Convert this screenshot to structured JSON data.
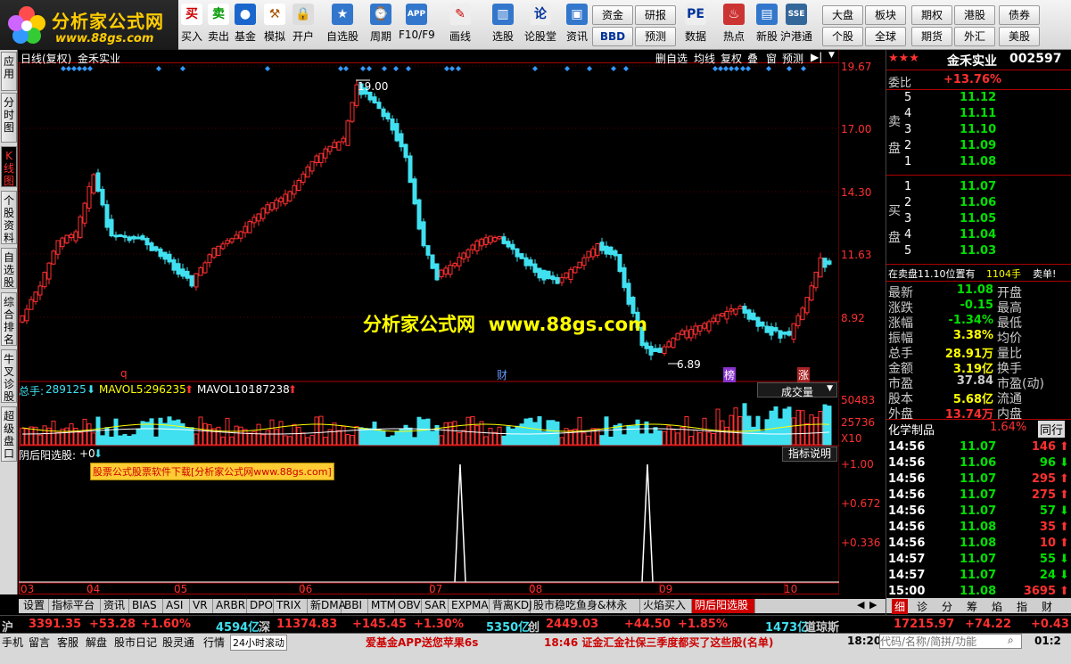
{
  "logo": {
    "title": "分析家公式网",
    "url": "www.88gs.com"
  },
  "toolbar": {
    "buttons": [
      {
        "label": "买入",
        "icon": "买"
      },
      {
        "label": "卖出",
        "icon": "卖"
      },
      {
        "label": "基金",
        "icon": "●"
      },
      {
        "label": "模拟",
        "icon": "⚒"
      },
      {
        "label": "开户",
        "icon": "🔒"
      },
      {
        "label": "自选股",
        "icon": "★"
      },
      {
        "label": "周期",
        "icon": "⌚"
      },
      {
        "label": "F10/F9",
        "icon": "APP"
      },
      {
        "label": "画线",
        "icon": "✎"
      },
      {
        "label": "选股",
        "icon": "▥"
      },
      {
        "label": "论股堂",
        "icon": "论"
      },
      {
        "label": "资讯",
        "icon": "▣"
      },
      {
        "label": "数据",
        "icon": "PE"
      },
      {
        "label": "热点",
        "icon": "♨"
      },
      {
        "label": "新股",
        "icon": "▤"
      },
      {
        "label": "沪港通",
        "icon": "SSE"
      }
    ],
    "small_buttons": [
      "资金",
      "BBD",
      "研报",
      "预测",
      "大盘",
      "个股",
      "板块",
      "全球",
      "期权",
      "期货",
      "港股",
      "外汇",
      "债券",
      "美股"
    ]
  },
  "sidetabs": [
    "应用",
    "分时图",
    "K线图",
    "个股资料",
    "自选股",
    "综合排名",
    "牛叉诊股",
    "超级盘口"
  ],
  "chart": {
    "title": "日线(复权)",
    "stock": "金禾实业",
    "top_buttons": [
      "删自选",
      "均线",
      "复权",
      "叠",
      "窗",
      "预测"
    ],
    "price_labels": [
      "19.67",
      "17.00",
      "14.30",
      "11.63",
      "8.92"
    ],
    "high_label": "19.00",
    "low_label": "6.89",
    "watermark": "分析家公式网  www.88gs.com",
    "markers": [
      "q",
      "财",
      "榜",
      "涨"
    ],
    "volume": {
      "total_label": "总手:",
      "total": "289125",
      "ma5_label": "MAVOL5:",
      "ma5": "296235",
      "ma10_label": "MAVOL10:",
      "ma10": "187238",
      "dropdown": "成交量",
      "labels": [
        "50483",
        "25736",
        "X10"
      ]
    },
    "indicator": {
      "name": "阴后阳选股:",
      "value": "+0",
      "button": "指标说明",
      "ad": "股票公式股票软件下载[分析家公式网www.88gs.com]",
      "labels": [
        "+1.00",
        "+0.672",
        "+0.336"
      ]
    },
    "months": [
      "03",
      "04",
      "05",
      "06",
      "07",
      "08",
      "09",
      "10"
    ]
  },
  "right": {
    "stars": "★★★",
    "name": "金禾实业",
    "code": "002597",
    "weibi_label": "委比",
    "weibi": "+13.76%",
    "sell_label": "卖盘",
    "buy_label": "买盘",
    "sells": [
      {
        "n": "5",
        "p": "11.12"
      },
      {
        "n": "4",
        "p": "11.11"
      },
      {
        "n": "3",
        "p": "11.10"
      },
      {
        "n": "2",
        "p": "11.09"
      },
      {
        "n": "1",
        "p": "11.08"
      }
    ],
    "buys": [
      {
        "n": "1",
        "p": "11.07"
      },
      {
        "n": "2",
        "p": "11.06"
      },
      {
        "n": "3",
        "p": "11.05"
      },
      {
        "n": "4",
        "p": "11.04"
      },
      {
        "n": "5",
        "p": "11.03"
      }
    ],
    "order_info": "在卖盘11.10位置有",
    "order_qty": "1104手",
    "order_btn": "卖单!",
    "stats": [
      {
        "l": "最新",
        "v": "11.08",
        "r": "开盘"
      },
      {
        "l": "涨跌",
        "v": "-0.15",
        "r": "最高"
      },
      {
        "l": "涨幅",
        "v": "-1.34%",
        "r": "最低"
      },
      {
        "l": "振幅",
        "v": "3.38%",
        "r": "均价"
      },
      {
        "l": "总手",
        "v": "28.91万",
        "r": "量比"
      },
      {
        "l": "金额",
        "v": "3.19亿",
        "r": "换手"
      },
      {
        "l": "市盈",
        "v": "37.84",
        "r": "市盈(动)"
      },
      {
        "l": "股本",
        "v": "5.68亿",
        "r": "流通"
      },
      {
        "l": "外盘",
        "v": "13.74万",
        "r": "内盘"
      }
    ],
    "sector": "化学制品",
    "sector_pct": "1.64%",
    "sector_btn": "同行",
    "ticks": [
      {
        "t": "14:56",
        "p": "11.07",
        "v": "146"
      },
      {
        "t": "14:56",
        "p": "11.06",
        "v": "96"
      },
      {
        "t": "14:56",
        "p": "11.07",
        "v": "295"
      },
      {
        "t": "14:56",
        "p": "11.07",
        "v": "275"
      },
      {
        "t": "14:56",
        "p": "11.07",
        "v": "57"
      },
      {
        "t": "14:56",
        "p": "11.08",
        "v": "35"
      },
      {
        "t": "14:56",
        "p": "11.08",
        "v": "10"
      },
      {
        "t": "14:57",
        "p": "11.07",
        "v": "55"
      },
      {
        "t": "14:57",
        "p": "11.07",
        "v": "24"
      },
      {
        "t": "15:00",
        "p": "11.08",
        "v": "3695"
      }
    ],
    "bottom_tabs": [
      "细",
      "诊",
      "分",
      "筹",
      "焰",
      "指",
      "财"
    ]
  },
  "bottom_tabs": [
    "设置",
    "指标平台",
    "资讯",
    "BIAS",
    "ASI",
    "VR",
    "ARBR",
    "DPO",
    "TRIX",
    "新DMA",
    "BBI",
    "MTM",
    "OBV",
    "SAR",
    "EXPMA",
    "背离KDJ",
    "股市稳吃鱼身&林永",
    "火焰买入",
    "阴后阳选股"
  ],
  "ticker": {
    "sh_label": "沪",
    "sh": "3391.35",
    "sh_chg": "+53.28",
    "sh_pct": "+1.60%",
    "sh_amt": "4594亿",
    "sz_label": "深",
    "sz": "11374.83",
    "sz_chg": "+145.45",
    "sz_pct": "+1.30%",
    "sz_amt": "5350亿",
    "cy_label": "创",
    "cy": "2449.03",
    "cy_chg": "+44.50",
    "cy_pct": "+1.85%",
    "cy_amt": "1473亿",
    "dj_label": "道琼斯",
    "dj": "17215.97",
    "dj_chg": "+74.22",
    "dj_pct": "+0.43"
  },
  "status": {
    "items": [
      "手机",
      "留言",
      "客服",
      "解盘",
      "股市日记",
      "股灵通",
      "行情",
      "24小时滚动"
    ],
    "news1": "爱基金APP送您苹果6s",
    "news2": "18:46 证金汇金社保三季度都买了这些股(名单)",
    "time": "18:20",
    "search_placeholder": "代码/名称/简拼/功能",
    "clock": "01:2"
  }
}
